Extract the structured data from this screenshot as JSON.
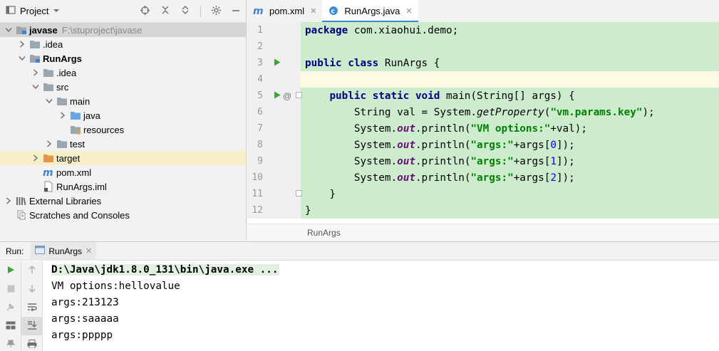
{
  "project": {
    "title": "Project",
    "tree": [
      {
        "label": "javase",
        "path": "F:\\stuproject\\javase",
        "bold": true,
        "level": 0,
        "expanded": true,
        "icon": "module-folder-icon",
        "selected": true
      },
      {
        "label": ".idea",
        "level": 1,
        "expanded": false,
        "icon": "folder-icon"
      },
      {
        "label": "RunArgs",
        "bold": true,
        "level": 1,
        "expanded": true,
        "icon": "module-folder-icon"
      },
      {
        "label": ".idea",
        "level": 2,
        "expanded": false,
        "icon": "folder-icon"
      },
      {
        "label": "src",
        "level": 2,
        "expanded": true,
        "icon": "folder-icon"
      },
      {
        "label": "main",
        "level": 3,
        "expanded": true,
        "icon": "folder-icon"
      },
      {
        "label": "java",
        "level": 4,
        "expanded": false,
        "icon": "source-folder-icon"
      },
      {
        "label": "resources",
        "level": 4,
        "leaf": true,
        "icon": "resources-folder-icon"
      },
      {
        "label": "test",
        "level": 3,
        "expanded": false,
        "icon": "folder-icon"
      },
      {
        "label": "target",
        "level": 2,
        "expanded": false,
        "icon": "excluded-folder-icon",
        "hover": true
      },
      {
        "label": "pom.xml",
        "level": 2,
        "leaf": true,
        "icon": "maven-icon"
      },
      {
        "label": "RunArgs.iml",
        "level": 2,
        "leaf": true,
        "icon": "iml-file-icon"
      },
      {
        "label": "External Libraries",
        "level": 0,
        "expanded": false,
        "icon": "libraries-icon"
      },
      {
        "label": "Scratches and Consoles",
        "level": 0,
        "leaf": true,
        "icon": "scratches-icon"
      }
    ]
  },
  "editor": {
    "tabs": [
      {
        "label": "pom.xml",
        "icon": "maven-icon",
        "active": false
      },
      {
        "label": "RunArgs.java",
        "icon": "java-class-icon",
        "active": true
      }
    ],
    "lines": [
      {
        "n": "1",
        "tokens": [
          {
            "t": "package",
            "c": "kw"
          },
          {
            "t": " com.xiaohui.demo;"
          }
        ]
      },
      {
        "n": "2",
        "tokens": []
      },
      {
        "n": "3",
        "run": true,
        "tokens": [
          {
            "t": "public class",
            "c": "kw"
          },
          {
            "t": " RunArgs {"
          }
        ]
      },
      {
        "n": "4",
        "current": true,
        "tokens": []
      },
      {
        "n": "5",
        "run": true,
        "at": true,
        "fold": true,
        "tokens": [
          {
            "t": "    "
          },
          {
            "t": "public static void",
            "c": "kw"
          },
          {
            "t": " main(String[] args) {"
          }
        ]
      },
      {
        "n": "6",
        "tokens": [
          {
            "t": "        String val = System."
          },
          {
            "t": "getProperty",
            "c": "ital"
          },
          {
            "t": "("
          },
          {
            "t": "\"vm.params.key\"",
            "c": "str"
          },
          {
            "t": ");"
          }
        ]
      },
      {
        "n": "7",
        "tokens": [
          {
            "t": "        System."
          },
          {
            "t": "out",
            "c": "fld"
          },
          {
            "t": ".println("
          },
          {
            "t": "\"VM options:\"",
            "c": "str"
          },
          {
            "t": "+val);"
          }
        ]
      },
      {
        "n": "8",
        "tokens": [
          {
            "t": "        System."
          },
          {
            "t": "out",
            "c": "fld"
          },
          {
            "t": ".println("
          },
          {
            "t": "\"args:\"",
            "c": "str"
          },
          {
            "t": "+args["
          },
          {
            "t": "0",
            "c": "num"
          },
          {
            "t": "]);"
          }
        ]
      },
      {
        "n": "9",
        "tokens": [
          {
            "t": "        System."
          },
          {
            "t": "out",
            "c": "fld"
          },
          {
            "t": ".println("
          },
          {
            "t": "\"args:\"",
            "c": "str"
          },
          {
            "t": "+args["
          },
          {
            "t": "1",
            "c": "num"
          },
          {
            "t": "]);"
          }
        ]
      },
      {
        "n": "10",
        "tokens": [
          {
            "t": "        System."
          },
          {
            "t": "out",
            "c": "fld"
          },
          {
            "t": ".println("
          },
          {
            "t": "\"args:\"",
            "c": "str"
          },
          {
            "t": "+args["
          },
          {
            "t": "2",
            "c": "num"
          },
          {
            "t": "]);"
          }
        ]
      },
      {
        "n": "11",
        "fold": true,
        "tokens": [
          {
            "t": "    }"
          }
        ]
      },
      {
        "n": "12",
        "tokens": [
          {
            "t": "}"
          }
        ]
      }
    ],
    "breadcrumb": "RunArgs"
  },
  "run": {
    "label": "Run:",
    "tab": "RunArgs",
    "output": [
      "D:\\Java\\jdk1.8.0_131\\bin\\java.exe ...",
      "VM options:hellovalue",
      "args:213123",
      "args:saaaaa",
      "args:ppppp"
    ]
  },
  "colors": {
    "keyword": "#000080",
    "string": "#008000",
    "number": "#0000ff",
    "field": "#660e7a",
    "code_bg": "#cdeccd",
    "current_line_bg": "#fcfae3",
    "run_green": "#3aa53a",
    "tab_underline": "#4083c9"
  }
}
